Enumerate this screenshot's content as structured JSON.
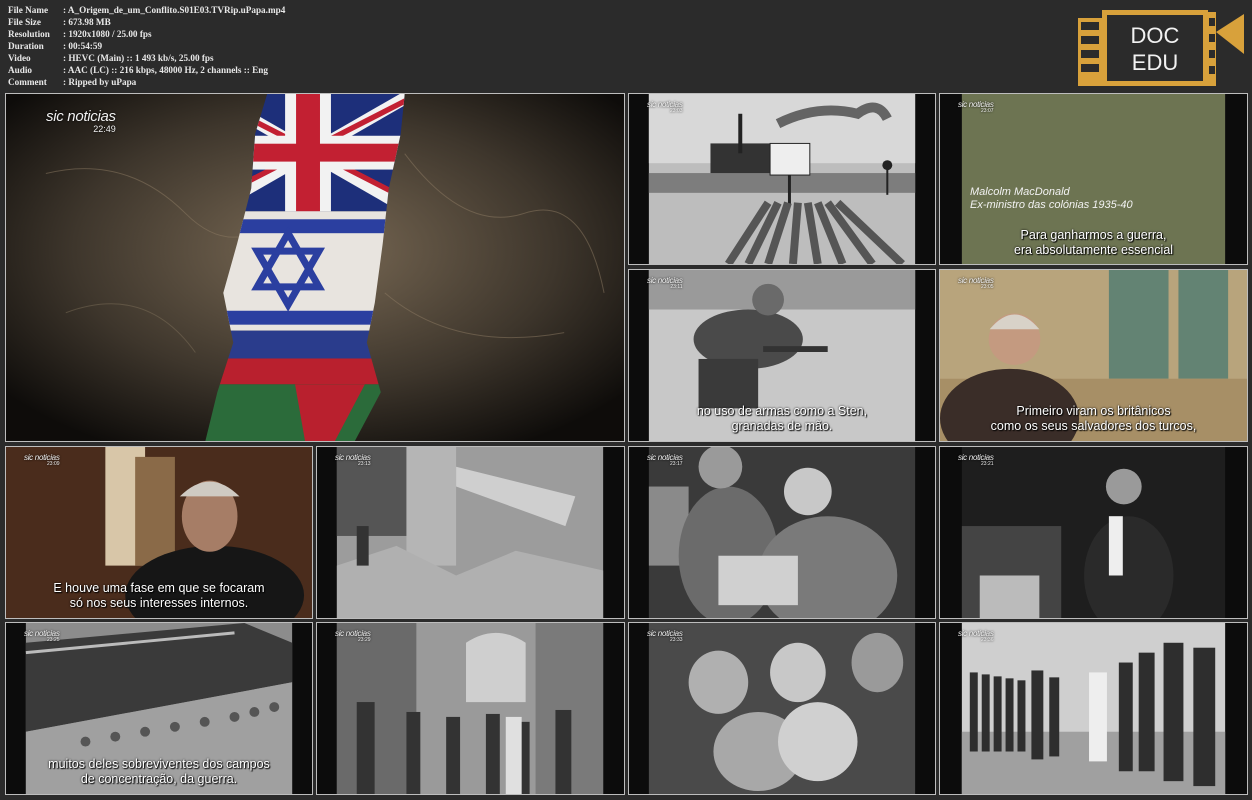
{
  "media_info": [
    {
      "label": "File Name",
      "value": ": A_Origem_de_um_Conflito.S01E03.TVRip.uPapa.mp4"
    },
    {
      "label": "File Size",
      "value": ": 673.98 MB"
    },
    {
      "label": "Resolution",
      "value": ": 1920x1080 / 25.00 fps"
    },
    {
      "label": "Duration",
      "value": ": 00:54:59"
    },
    {
      "label": "Video",
      "value": ": HEVC (Main) :: 1 493 kb/s, 25.00 fps"
    },
    {
      "label": "Audio",
      "value": ": AAC (LC) :: 216 kbps, 48000 Hz, 2 channels :: Eng"
    },
    {
      "label": "Comment",
      "value": ": Ripped by uPapa"
    }
  ],
  "logo": {
    "line1": "DOC",
    "line2": "EDU",
    "color": "#d8a13b"
  },
  "brand_name": "sic noticias",
  "main_frame": {
    "timestamp": "22:49"
  },
  "frames": [
    {
      "timestamp": "23:03",
      "subtitle": []
    },
    {
      "timestamp": "23:07",
      "caption": [
        "Malcolm MacDonald",
        "Ex-ministro das colónias 1935-40"
      ],
      "subtitle": [
        "Para ganharmos a guerra,",
        "era absolutamente essencial"
      ]
    },
    {
      "timestamp": "23:11",
      "subtitle": [
        "no uso de armas como a Sten,",
        "granadas de mão."
      ]
    },
    {
      "timestamp": "23:05",
      "subtitle": [
        "Primeiro viram os britânicos",
        "como os seus salvadores dos turcos,"
      ]
    },
    {
      "timestamp": "23:09",
      "subtitle": [
        "E houve uma fase em que se focaram",
        "só nos seus interesses internos."
      ]
    },
    {
      "timestamp": "23:13",
      "subtitle": []
    },
    {
      "timestamp": "23:17",
      "subtitle": []
    },
    {
      "timestamp": "23:21",
      "subtitle": []
    },
    {
      "timestamp": "23:25",
      "subtitle": [
        "muitos deles sobreviventes dos campos",
        "de concentração, da guerra."
      ]
    },
    {
      "timestamp": "23:29",
      "subtitle": []
    },
    {
      "timestamp": "23:33",
      "subtitle": []
    },
    {
      "timestamp": "23:36",
      "subtitle": []
    }
  ]
}
